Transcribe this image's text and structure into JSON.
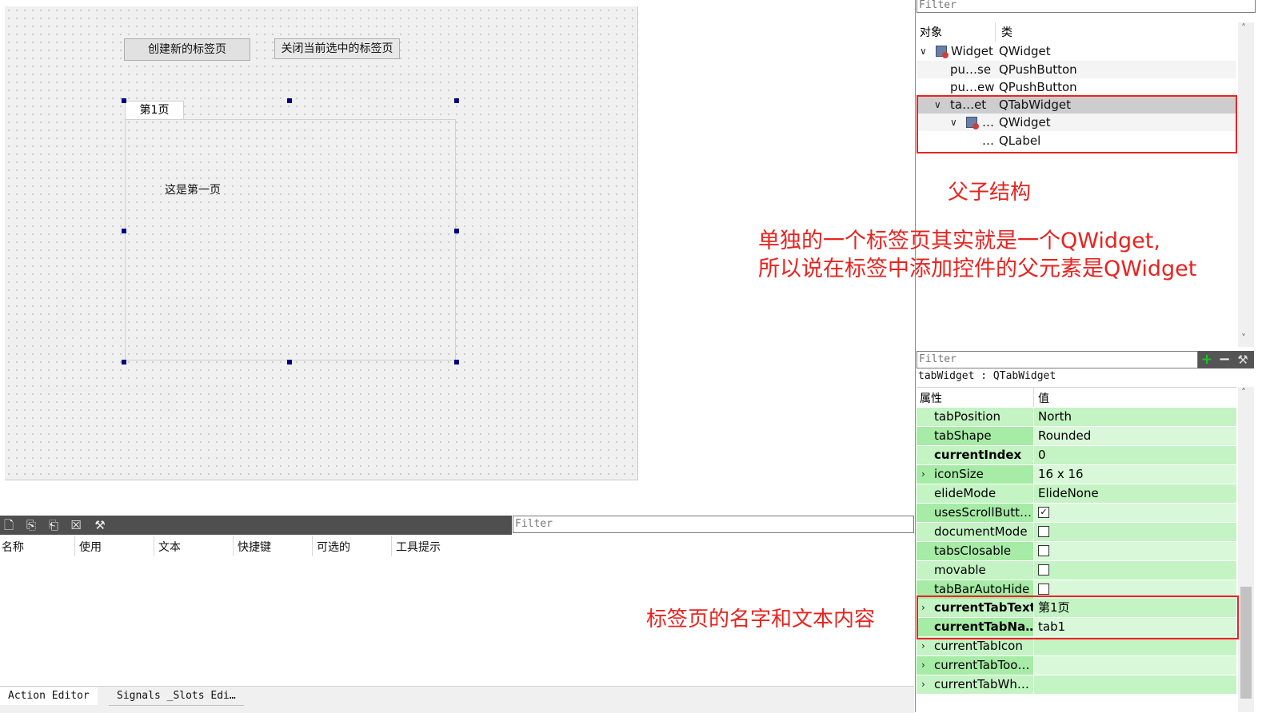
{
  "designer": {
    "btn_create": "创建新的标签页",
    "btn_close": "关闭当前选中的标签页",
    "tab_title": "第1页",
    "label_text": "这是第一页"
  },
  "action_editor": {
    "filter_placeholder": "Filter",
    "columns": [
      "名称",
      "使用",
      "文本",
      "快捷键",
      "可选的",
      "工具提示"
    ],
    "tabs": [
      "Action Editor",
      "Signals _Slots Edi…"
    ]
  },
  "object_inspector": {
    "filter_placeholder": "Filter",
    "col_object": "对象",
    "col_class": "类",
    "rows": [
      {
        "name": "Widget",
        "class": "QWidget"
      },
      {
        "name": "pu…se",
        "class": "QPushButton"
      },
      {
        "name": "pu…ew",
        "class": "QPushButton"
      },
      {
        "name": "ta…et",
        "class": "QTabWidget"
      },
      {
        "name": "…",
        "class": "QWidget"
      },
      {
        "name": "…",
        "class": "QLabel"
      }
    ]
  },
  "annotations": {
    "parent_child": "父子结构",
    "explain_line1": "单独的一个标签页其实就是一个QWidget,",
    "explain_line2": "所以说在标签中添加控件的父元素是QWidget",
    "tab_name_text": "标签页的名字和文本内容"
  },
  "property_editor": {
    "filter_placeholder": "Filter",
    "object_line": "tabWidget : QTabWidget",
    "col_property": "属性",
    "col_value": "值",
    "rows": [
      {
        "name": "tabPosition",
        "value": "North",
        "bold": false,
        "expand": false
      },
      {
        "name": "tabShape",
        "value": "Rounded",
        "bold": false,
        "expand": false
      },
      {
        "name": "currentIndex",
        "value": "0",
        "bold": true,
        "expand": false
      },
      {
        "name": "iconSize",
        "value": "16 x 16",
        "bold": false,
        "expand": true
      },
      {
        "name": "elideMode",
        "value": "ElideNone",
        "bold": false,
        "expand": false
      },
      {
        "name": "usesScrollButt…",
        "value": "",
        "checkbox": true,
        "checked": true,
        "bold": false,
        "expand": false
      },
      {
        "name": "documentMode",
        "value": "",
        "checkbox": true,
        "checked": false,
        "bold": false,
        "expand": false
      },
      {
        "name": "tabsClosable",
        "value": "",
        "checkbox": true,
        "checked": false,
        "bold": false,
        "expand": false
      },
      {
        "name": "movable",
        "value": "",
        "checkbox": true,
        "checked": false,
        "bold": false,
        "expand": false
      },
      {
        "name": "tabBarAutoHide",
        "value": "",
        "checkbox": true,
        "checked": false,
        "bold": false,
        "expand": false
      },
      {
        "name": "currentTabText",
        "value": "第1页",
        "bold": true,
        "expand": true
      },
      {
        "name": "currentTabNa…",
        "value": "tab1",
        "bold": true,
        "expand": false
      },
      {
        "name": "currentTabIcon",
        "value": "",
        "bold": false,
        "expand": true
      },
      {
        "name": "currentTabToo…",
        "value": "",
        "bold": false,
        "expand": true
      },
      {
        "name": "currentTabWh…",
        "value": "",
        "bold": false,
        "expand": true
      }
    ]
  },
  "colors": {
    "annotation_red": "#e8231f",
    "prop_green_dark": "#a6eba6",
    "prop_green_light": "#c4f3c4",
    "selection_handle": "#000080"
  }
}
